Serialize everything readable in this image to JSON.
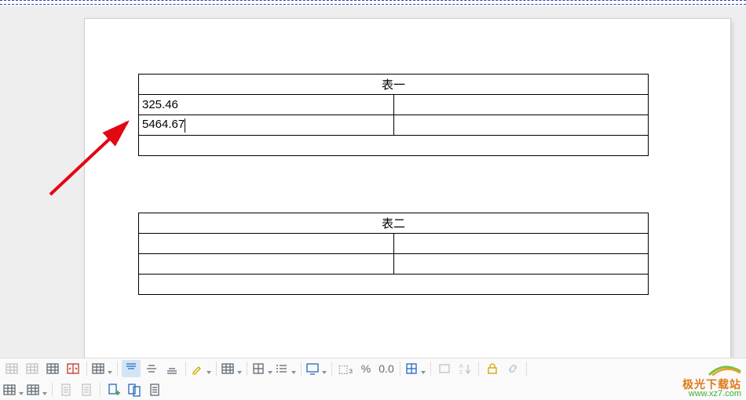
{
  "tables": [
    {
      "title": "表一",
      "rows": [
        [
          "325.46",
          ""
        ],
        [
          "5464.67",
          ""
        ],
        [
          "",
          ""
        ]
      ]
    },
    {
      "title": "表二",
      "rows": [
        [
          "",
          ""
        ],
        [
          "",
          ""
        ],
        [
          "",
          ""
        ]
      ]
    }
  ],
  "toolbar_row1": {
    "btns": [
      {
        "name": "table-insert-icon",
        "dd": false,
        "dis": true
      },
      {
        "name": "table-highlight-icon",
        "dd": false,
        "dis": true
      },
      {
        "name": "table-style-icon",
        "dd": false,
        "dis": false
      },
      {
        "name": "table-split-icon",
        "dd": false,
        "dis": false,
        "color": "#c0392b"
      },
      {
        "name": "row-ops-icon",
        "dd": true,
        "dis": false
      },
      {
        "name": "valign-top-icon",
        "dd": false,
        "dis": false,
        "active": true
      },
      {
        "name": "valign-middle-icon",
        "dd": false,
        "dis": false
      },
      {
        "name": "valign-bottom-icon",
        "dd": false,
        "dis": false
      },
      {
        "name": "highlighter-icon",
        "dd": true,
        "dis": false,
        "color": "#d1a400"
      },
      {
        "name": "table-format-icon",
        "dd": true,
        "dis": false
      },
      {
        "name": "borders-icon",
        "dd": true,
        "dis": false
      },
      {
        "name": "list-icon",
        "dd": true,
        "dis": false
      },
      {
        "name": "screen-icon",
        "dd": true,
        "dis": false,
        "color": "#2268c0"
      },
      {
        "name": "number-format-icon",
        "dd": false,
        "dis": false,
        "text": "⬚₃"
      },
      {
        "name": "percent-icon",
        "dd": false,
        "dis": false,
        "text": "%"
      },
      {
        "name": "decimal-icon",
        "dd": false,
        "dis": false,
        "text": "0.0"
      },
      {
        "name": "grid-toggle-icon",
        "dd": true,
        "dis": false,
        "color": "#2268c0"
      },
      {
        "name": "shape-icon",
        "dd": false,
        "dis": true
      },
      {
        "name": "sort-az-icon",
        "dd": false,
        "dis": true
      },
      {
        "name": "lock-icon",
        "dd": false,
        "dis": false,
        "color": "#d1a400"
      },
      {
        "name": "link-icon",
        "dd": false,
        "dis": true
      }
    ]
  },
  "toolbar_row2": {
    "btns": [
      {
        "name": "new-table-icon",
        "dd": true,
        "dis": false
      },
      {
        "name": "new-row-icon",
        "dd": true,
        "dis": false
      },
      {
        "name": "page-one-icon",
        "dd": false,
        "dis": true
      },
      {
        "name": "page-two-icon",
        "dd": false,
        "dis": true
      },
      {
        "name": "doc-add-icon",
        "dd": false,
        "dis": false,
        "color": "#2268c0"
      },
      {
        "name": "doc-merge-icon",
        "dd": false,
        "dis": false,
        "color": "#2268c0"
      },
      {
        "name": "doc-list-icon",
        "dd": false,
        "dis": false
      }
    ]
  },
  "watermark": {
    "brand": "极光下载站",
    "url": "www.xz7.com"
  }
}
